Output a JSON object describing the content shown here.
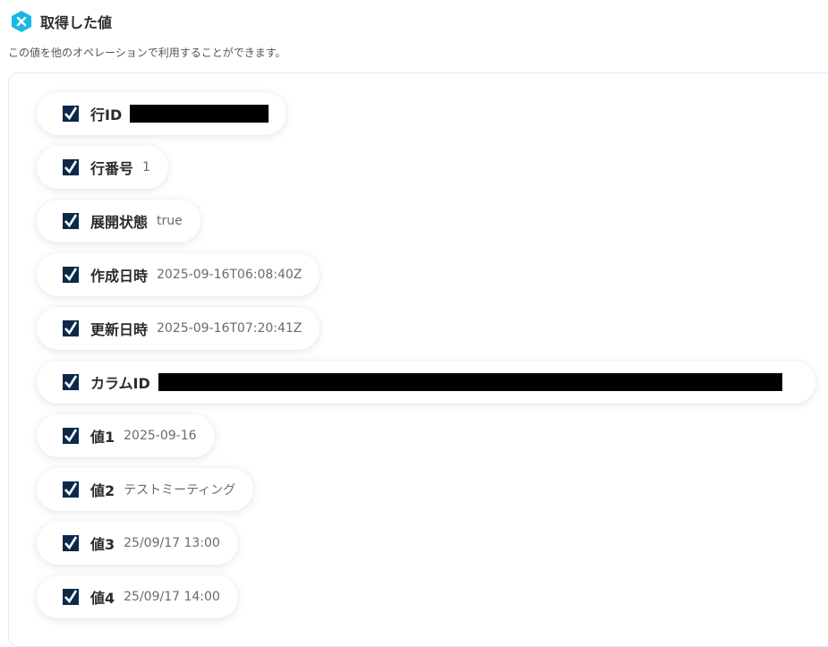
{
  "header": {
    "title": "取得した値",
    "subtitle": "この値を他のオペレーションで利用することができます。"
  },
  "items": [
    {
      "label": "行ID",
      "value": ""
    },
    {
      "label": "行番号",
      "value": "1"
    },
    {
      "label": "展開状態",
      "value": "true"
    },
    {
      "label": "作成日時",
      "value": "2025-09-16T06:08:40Z"
    },
    {
      "label": "更新日時",
      "value": "2025-09-16T07:20:41Z"
    },
    {
      "label": "カラムID",
      "value": ""
    },
    {
      "label": "値1",
      "value": "2025-09-16"
    },
    {
      "label": "値2",
      "value": "テストミーティング"
    },
    {
      "label": "値3",
      "value": "25/09/17 13:00"
    },
    {
      "label": "値4",
      "value": "25/09/17 14:00"
    }
  ],
  "colors": {
    "logo": "#1ab7e6",
    "check": "#0b2a4a",
    "border": "#e4e7ec"
  },
  "icons": {
    "logo": "yoom-hexagon-icon",
    "check": "checkbox-checked-icon"
  }
}
